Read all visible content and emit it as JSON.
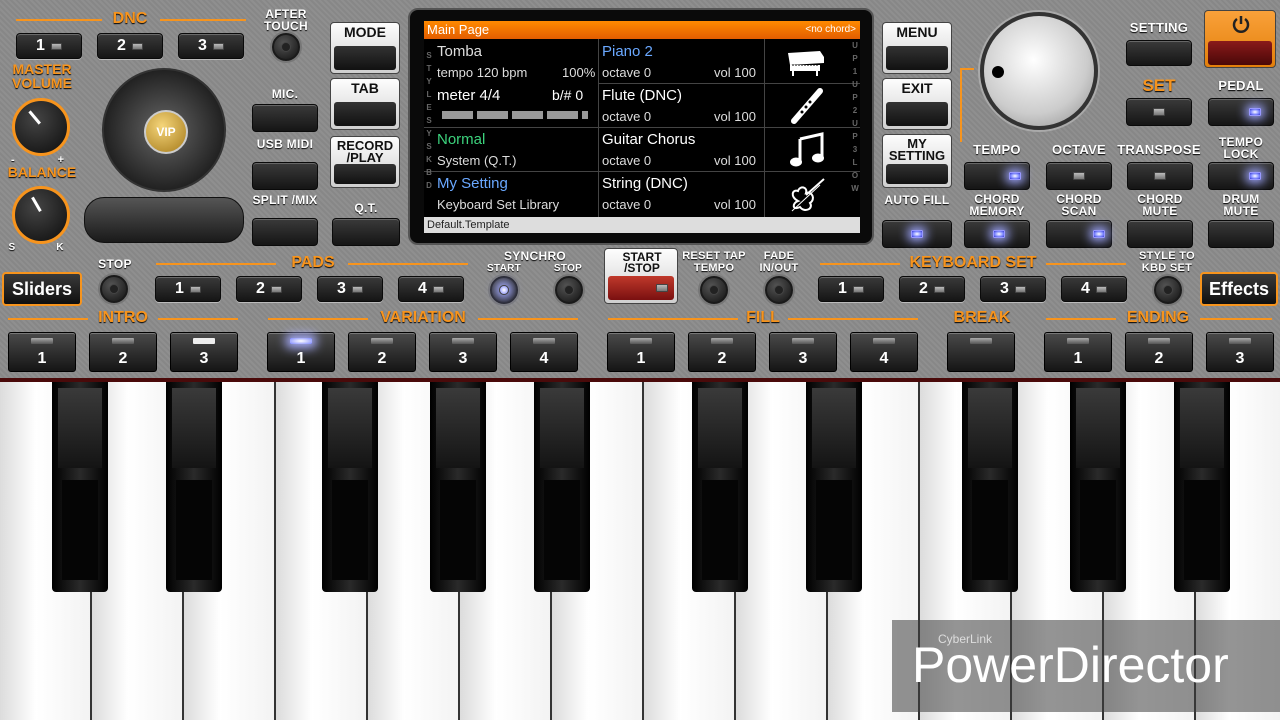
{
  "dnc": {
    "label": "DNC",
    "buttons": [
      "1",
      "2",
      "3"
    ]
  },
  "after_touch": "AFTER TOUCH",
  "master_volume": "MASTER VOLUME",
  "balance": {
    "label": "BALANCE",
    "left": "S",
    "right": "K"
  },
  "vol_minmax": {
    "min": "-",
    "max": "+"
  },
  "logo": "VIP",
  "left_column": {
    "mic": "MIC.",
    "usb_midi": "USB MIDI",
    "split_mix": "SPLIT /MIX",
    "qt": "Q.T."
  },
  "mode_buttons": {
    "mode": "MODE",
    "tab": "TAB",
    "record_play": "RECORD /PLAY"
  },
  "screen": {
    "title": "Main Page",
    "chord": "<no chord>",
    "style_name": "Tomba",
    "tempo": "tempo 120 bpm",
    "percent": "100%",
    "meter": "meter 4/4",
    "bsharp": "b/# 0",
    "sys_name": "Normal",
    "sys_sub": "System (Q.T.)",
    "kbd_name": "My Setting",
    "kbd_sub": "Keyboard Set Library",
    "voices": [
      {
        "name": "Piano 2",
        "octave": "octave 0",
        "vol": "vol 100"
      },
      {
        "name": "Flute (DNC)",
        "octave": "octave 0",
        "vol": "vol 100"
      },
      {
        "name": "Guitar Chorus",
        "octave": "octave 0",
        "vol": "vol 100"
      },
      {
        "name": "String (DNC)",
        "octave": "octave 0",
        "vol": "vol 100"
      }
    ],
    "left_vert": [
      "S",
      "T",
      "Y",
      "L",
      "E",
      "S",
      "Y",
      "S",
      "K",
      "B",
      "D"
    ],
    "right_vert": [
      "U",
      "P",
      "1",
      "U",
      "P",
      "2",
      "U",
      "P",
      "3",
      "L",
      "O",
      "W"
    ],
    "footer": "Default.Template"
  },
  "right_menu": {
    "menu": "MENU",
    "exit": "EXIT",
    "my_setting": "MY SETTING",
    "auto_fill": "AUTO FILL"
  },
  "top_right": {
    "setting": "SETTING",
    "set": "SET",
    "pedal": "PEDAL"
  },
  "func_row1": [
    "TEMPO",
    "OCTAVE",
    "TRANSPOSE",
    "TEMPO LOCK"
  ],
  "func_row2": [
    "CHORD MEMORY",
    "CHORD SCAN",
    "CHORD MUTE",
    "DRUM MUTE"
  ],
  "pads": {
    "label": "PADS",
    "stop": "STOP",
    "buttons": [
      "1",
      "2",
      "3",
      "4"
    ]
  },
  "synchro": {
    "label": "SYNCHRO",
    "start": "START",
    "stop": "STOP"
  },
  "start_stop": "START /STOP",
  "reset": "RESET TAP TEMPO",
  "fade": "FADE IN/OUT",
  "keyboard_set": {
    "label": "KEYBOARD SET",
    "buttons": [
      "1",
      "2",
      "3",
      "4"
    ]
  },
  "style_to_kbd": "STYLE TO KBD SET",
  "sliders": "Sliders",
  "effects": "Effects",
  "sections": {
    "intro": "INTRO",
    "variation": "VARIATION",
    "fill": "FILL",
    "break": "BREAK",
    "ending": "ENDING"
  },
  "bottom_pads": [
    "1",
    "2",
    "3",
    "1",
    "2",
    "3",
    "4",
    "1",
    "2",
    "3",
    "4",
    "",
    "1",
    "2",
    "3"
  ],
  "active_variation": "1",
  "watermark": {
    "brand": "CyberLink",
    "product": "PowerDirector"
  },
  "colors": {
    "accent": "#f7941d",
    "led_on": "#7c86ff",
    "screen_header": "#ff7a00",
    "start_stop": "#c0392b"
  }
}
